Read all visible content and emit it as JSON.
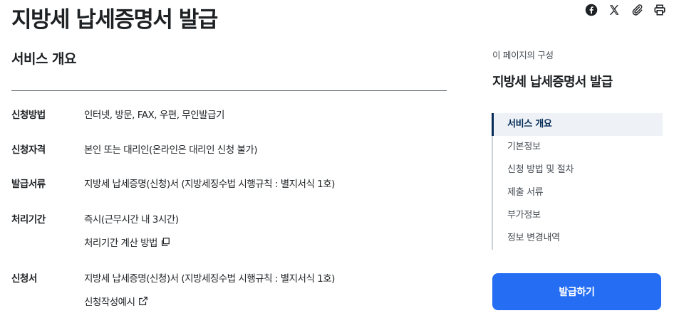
{
  "page": {
    "title": "지방세 납세증명서 발급"
  },
  "share_icons": [
    "facebook-icon",
    "x-icon",
    "paperclip-icon",
    "printer-icon"
  ],
  "overview": {
    "title": "서비스 개요",
    "rows": [
      {
        "label": "신청방법",
        "value": "인터넷, 방문, FAX, 우편, 무인발급기"
      },
      {
        "label": "신청자격",
        "value": "본인 또는 대리인(온라인은 대리인 신청 불가)"
      },
      {
        "label": "발급서류",
        "value": "지방세 납세증명(신청)서 (지방세징수법 시행규칙 : 별지서식 1호)"
      },
      {
        "label": "처리기간",
        "value": "즉시(근무시간 내 3시간)",
        "link": "처리기간 계산 방법"
      },
      {
        "label": "신청서",
        "value": "지방세 납세증명(신청)서 (지방세징수법 시행규칙 : 별지서식 1호)",
        "link": "신청작성예시"
      }
    ]
  },
  "toc": {
    "caption": "이 페이지의 구성",
    "title": "지방세 납세증명서 발급",
    "items": [
      "서비스 개요",
      "기본정보",
      "신청 방법 및 절차",
      "제출 서류",
      "부가정보",
      "정보 변경내역"
    ],
    "active_index": 0
  },
  "action": {
    "issue_label": "발급하기"
  },
  "colors": {
    "primary": "#256ef4",
    "active_nav": "#052b57",
    "text": "#1e2124"
  }
}
